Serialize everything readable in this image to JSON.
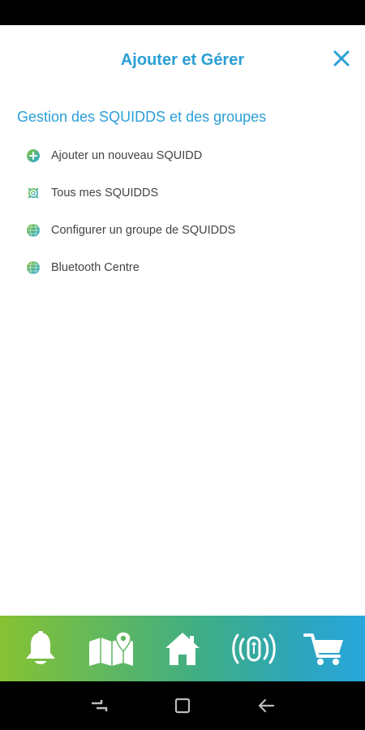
{
  "header": {
    "title": "Ajouter et Gérer"
  },
  "section": {
    "title": "Gestion des SQUIDDS et des groupes"
  },
  "menu": {
    "items": [
      {
        "label": "Ajouter un nouveau SQUIDD",
        "icon": "plus-circle-icon"
      },
      {
        "label": "Tous mes SQUIDDS",
        "icon": "gear-icon"
      },
      {
        "label": "Configurer un groupe de SQUIDDS",
        "icon": "globe-icon"
      },
      {
        "label": "Bluetooth Centre",
        "icon": "globe-icon"
      }
    ]
  },
  "bottom_nav": {
    "items": [
      {
        "icon": "bell-icon"
      },
      {
        "icon": "map-icon"
      },
      {
        "icon": "home-icon"
      },
      {
        "icon": "squidd-device-icon"
      },
      {
        "icon": "cart-icon"
      }
    ]
  },
  "system_nav": {
    "items": [
      {
        "icon": "recents-icon"
      },
      {
        "icon": "home-square-icon"
      },
      {
        "icon": "back-arrow-icon"
      }
    ]
  },
  "colors": {
    "accent": "#2a9fd6",
    "text": "#444444",
    "gradient_start": "#86c232",
    "gradient_end": "#27a6dc"
  }
}
